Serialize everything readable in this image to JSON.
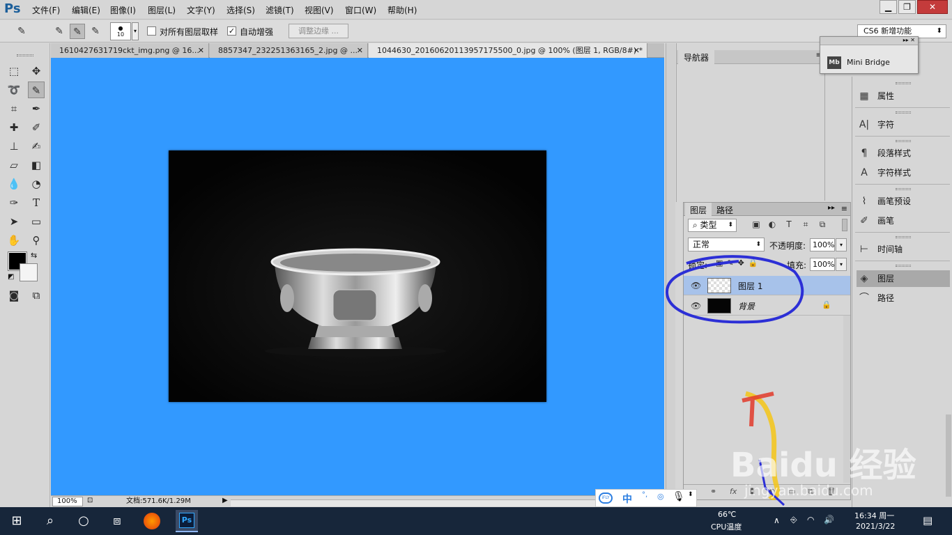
{
  "app": {
    "logo": "Ps"
  },
  "menu": [
    "文件(F)",
    "编辑(E)",
    "图像(I)",
    "图层(L)",
    "文字(Y)",
    "选择(S)",
    "滤镜(T)",
    "视图(V)",
    "窗口(W)",
    "帮助(H)"
  ],
  "window_buttons": {
    "minimize": "▁",
    "restore": "❐",
    "close": "✕"
  },
  "options": {
    "brush_size": "10",
    "sample_all_label": "对所有图层取样",
    "sample_all_checked": false,
    "auto_enhance_label": "自动增强",
    "auto_enhance_checked": true,
    "check_mark": "✓",
    "refine_edge_label": "调整边缘 ...",
    "workspace": "CS6 新增功能"
  },
  "tabs": [
    {
      "label": "1610427631719ckt_img.png @ 16..."
    },
    {
      "label": "8857347_232251363165_2.jpg @ ..."
    },
    {
      "label": "1044630_20160620113957175500_0.jpg @ 100% (图层 1, RGB/8#) *"
    }
  ],
  "status": {
    "zoom": "100%",
    "doc_info": "文档:571.6K/1.29M"
  },
  "navigator": {
    "tab": "导航器"
  },
  "mini_bridge": {
    "icon": "Mb",
    "label": "Mini Bridge"
  },
  "right_panels": [
    {
      "label": "属性",
      "icon": "properties-icon"
    },
    {
      "label": "字符",
      "icon": "character-icon"
    },
    {
      "label": "段落样式",
      "icon": "paragraph-styles-icon"
    },
    {
      "label": "字符样式",
      "icon": "character-styles-icon"
    },
    {
      "label": "画笔预设",
      "icon": "brush-presets-icon"
    },
    {
      "label": "画笔",
      "icon": "brush-icon"
    },
    {
      "label": "时间轴",
      "icon": "timeline-icon"
    },
    {
      "label": "图层",
      "icon": "layers-icon"
    },
    {
      "label": "路径",
      "icon": "paths-icon"
    }
  ],
  "layers_panel": {
    "tabs": [
      "图层",
      "路径"
    ],
    "filter": "类型",
    "blend_mode": "正常",
    "opacity_label": "不透明度:",
    "opacity": "100%",
    "lock_label": "锁定:",
    "fill_label": "填充:",
    "fill": "100%",
    "layers": [
      {
        "name": "图层 1",
        "selected": true
      },
      {
        "name": "背景",
        "selected": false,
        "locked": true
      }
    ],
    "bottom_fx": "fx"
  },
  "taskbar": {
    "temp": "66℃",
    "temp_label": "CPU温度",
    "time": "16:34 周一",
    "date": "2021/3/22"
  },
  "ime": {
    "logo": "iFLY",
    "mode": "中"
  },
  "watermark": {
    "brand": "Baidu 经验",
    "url": "jingyan.baidu.com"
  }
}
